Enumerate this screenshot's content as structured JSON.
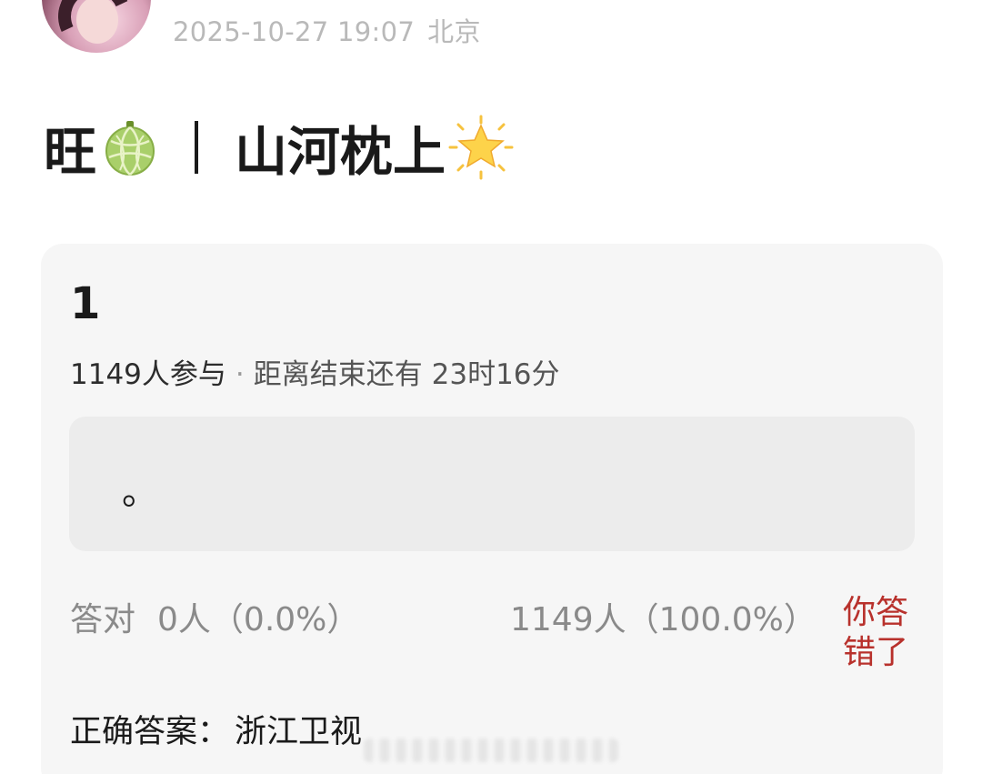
{
  "header": {
    "avatar_icon": "user-avatar",
    "timestamp": "2025-10-27 19:07",
    "location": "北京"
  },
  "post": {
    "title_left": "旺",
    "title_left_icon": "melon-icon",
    "title_right": "山河枕上",
    "title_right_icon": "glowing-star-icon"
  },
  "quiz": {
    "number": "1",
    "participants": "1149人参与",
    "separator": "·",
    "countdown": "距离结束还有 23时16分",
    "option_text": "。",
    "correct_label": "答对",
    "correct_count": "0人（0.0%）",
    "wrong_count": "1149人（100.0%）",
    "user_result": "你答错了",
    "answer_label": "正确答案：",
    "answer_value": "浙江卫视"
  },
  "colors": {
    "background": "#ffffff",
    "card": "#f6f6f6",
    "option_box": "#ececec",
    "wrong_red": "#b8312c",
    "muted_text": "#8a8a8a"
  }
}
